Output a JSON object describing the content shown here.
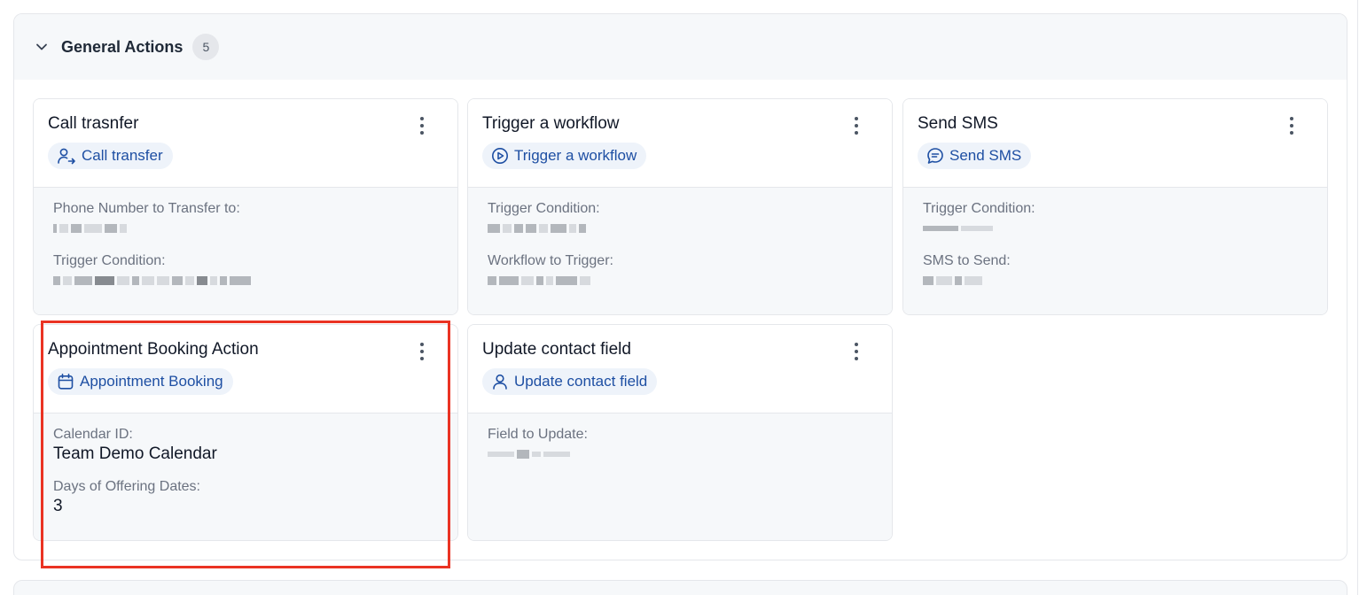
{
  "section": {
    "title": "General Actions",
    "count": "5"
  },
  "cards": [
    {
      "title": "Call trasnfer",
      "chip_label": "Call transfer",
      "chip_icon": "user-transfer-icon",
      "fields": [
        {
          "label": "Phone Number to Transfer to:",
          "value": ""
        },
        {
          "label": "Trigger Condition:",
          "value": ""
        }
      ]
    },
    {
      "title": "Trigger a workflow",
      "chip_label": "Trigger a workflow",
      "chip_icon": "play-circle-icon",
      "fields": [
        {
          "label": "Trigger Condition:",
          "value": ""
        },
        {
          "label": "Workflow to Trigger:",
          "value": ""
        }
      ]
    },
    {
      "title": "Send SMS",
      "chip_label": "Send SMS",
      "chip_icon": "message-icon",
      "fields": [
        {
          "label": "Trigger Condition:",
          "value": ""
        },
        {
          "label": "SMS to Send:",
          "value": ""
        }
      ]
    },
    {
      "title": "Appointment Booking Action",
      "chip_label": "Appointment Booking",
      "chip_icon": "calendar-icon",
      "fields": [
        {
          "label": "Calendar ID:",
          "value": "Team Demo Calendar"
        },
        {
          "label": "Days of Offering Dates:",
          "value": "3"
        }
      ]
    },
    {
      "title": "Update contact field",
      "chip_label": "Update contact field",
      "chip_icon": "user-icon",
      "fields": [
        {
          "label": "Field to Update:",
          "value": ""
        }
      ]
    }
  ],
  "colors": {
    "chip_text": "#1e4fa3",
    "chip_bg": "#eef3fa",
    "highlight": "#ea3323",
    "header_bg": "#f6f8fa"
  }
}
